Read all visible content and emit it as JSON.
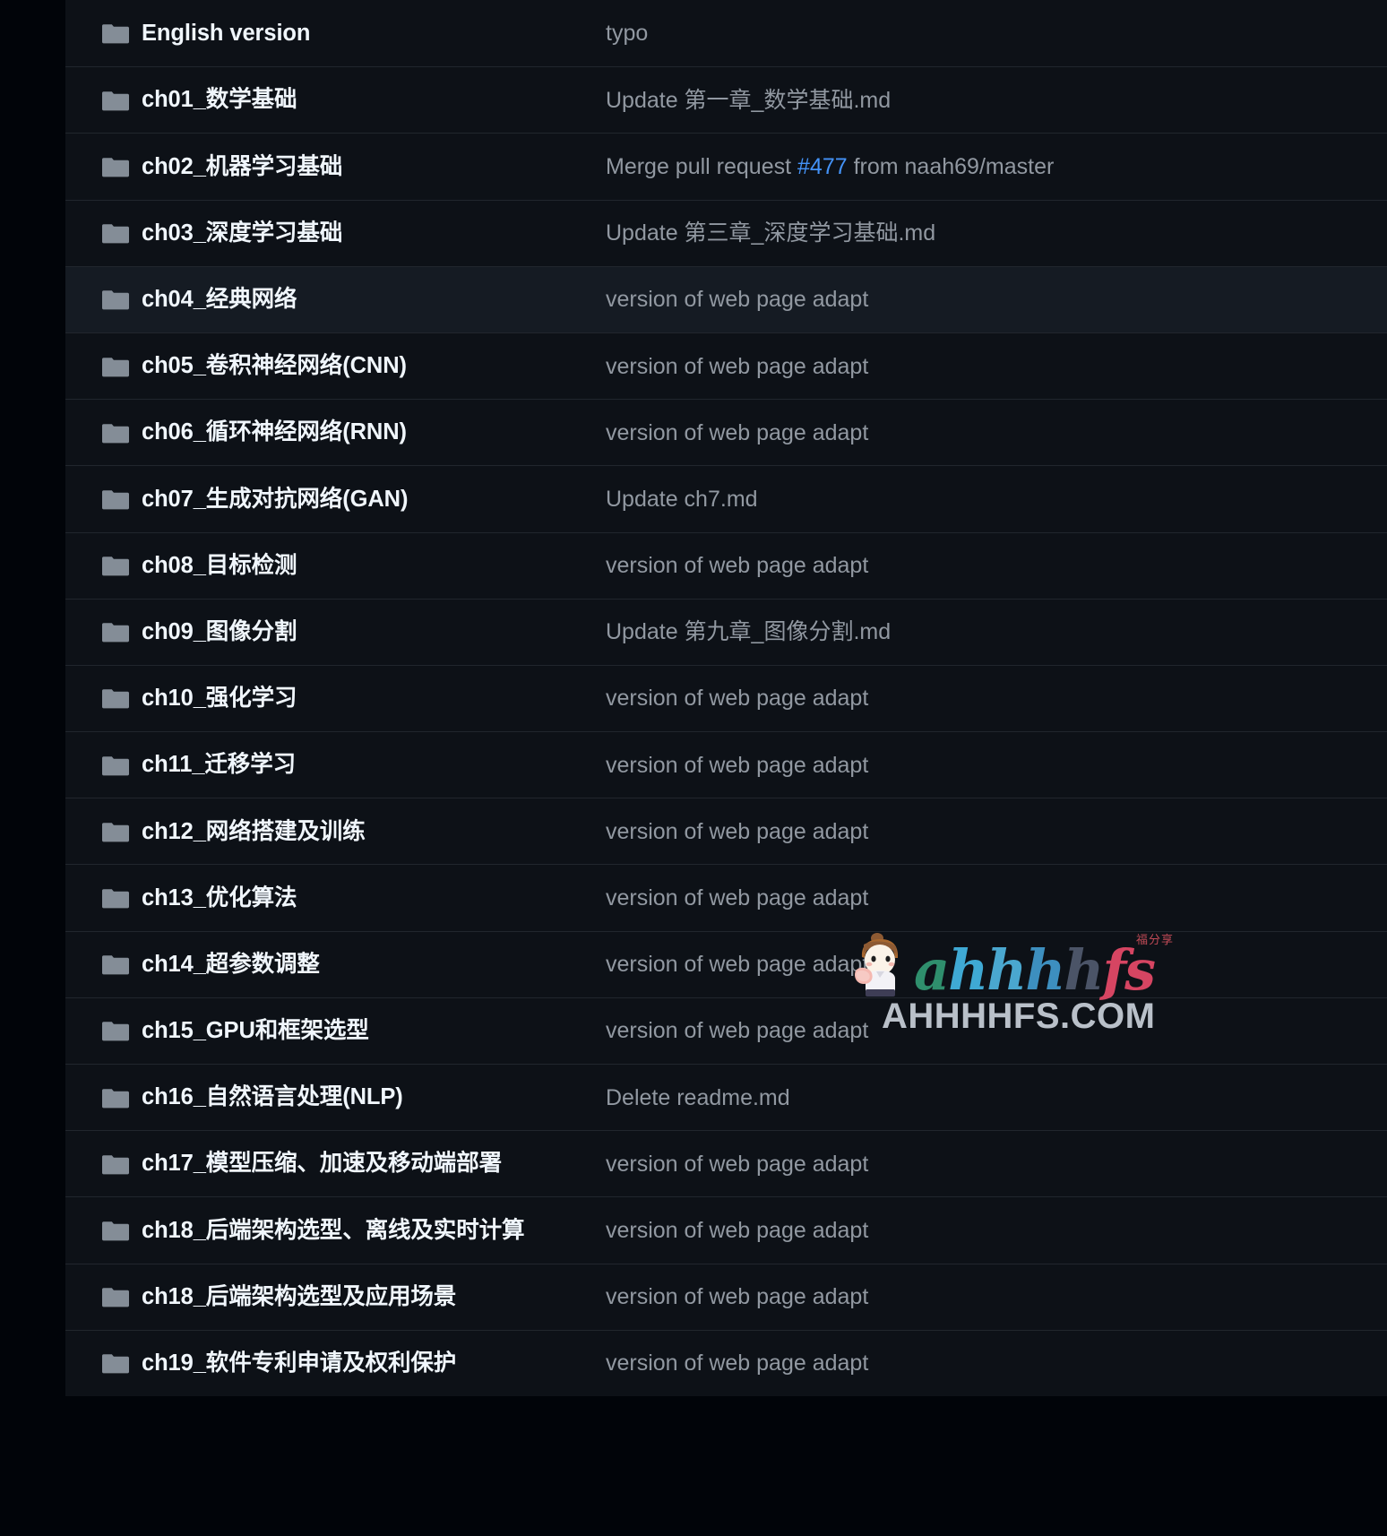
{
  "theme": {
    "page_bg": "#010409",
    "row_bg": "#0d1117",
    "row_bg_alt": "#151b23",
    "row_border": "#21262d",
    "name_color": "#f0f6fc",
    "message_color": "#9198a1",
    "link_color": "#4493f8",
    "folder_icon_color": "#848d97"
  },
  "icons": {
    "folder": "folder-icon"
  },
  "file_list": {
    "columns": [
      "name",
      "last_commit_message"
    ],
    "rows": [
      {
        "icon": "folder-icon",
        "name": "English version",
        "message_pre": "typo",
        "message_link": "",
        "message_post": "",
        "highlighted": false
      },
      {
        "icon": "folder-icon",
        "name": "ch01_数学基础",
        "message_pre": "Update 第一章_数学基础.md",
        "message_link": "",
        "message_post": "",
        "highlighted": false
      },
      {
        "icon": "folder-icon",
        "name": "ch02_机器学习基础",
        "message_pre": "Merge pull request ",
        "message_link": "#477",
        "message_post": " from naah69/master",
        "highlighted": false
      },
      {
        "icon": "folder-icon",
        "name": "ch03_深度学习基础",
        "message_pre": "Update 第三章_深度学习基础.md",
        "message_link": "",
        "message_post": "",
        "highlighted": false
      },
      {
        "icon": "folder-icon",
        "name": "ch04_经典网络",
        "message_pre": "version of web page adapt",
        "message_link": "",
        "message_post": "",
        "highlighted": true
      },
      {
        "icon": "folder-icon",
        "name": "ch05_卷积神经网络(CNN)",
        "message_pre": "version of web page adapt",
        "message_link": "",
        "message_post": "",
        "highlighted": false
      },
      {
        "icon": "folder-icon",
        "name": "ch06_循环神经网络(RNN)",
        "message_pre": "version of web page adapt",
        "message_link": "",
        "message_post": "",
        "highlighted": false
      },
      {
        "icon": "folder-icon",
        "name": "ch07_生成对抗网络(GAN)",
        "message_pre": "Update ch7.md",
        "message_link": "",
        "message_post": "",
        "highlighted": false
      },
      {
        "icon": "folder-icon",
        "name": "ch08_目标检测",
        "message_pre": "version of web page adapt",
        "message_link": "",
        "message_post": "",
        "highlighted": false
      },
      {
        "icon": "folder-icon",
        "name": "ch09_图像分割",
        "message_pre": "Update 第九章_图像分割.md",
        "message_link": "",
        "message_post": "",
        "highlighted": false
      },
      {
        "icon": "folder-icon",
        "name": "ch10_强化学习",
        "message_pre": "version of web page adapt",
        "message_link": "",
        "message_post": "",
        "highlighted": false
      },
      {
        "icon": "folder-icon",
        "name": "ch11_迁移学习",
        "message_pre": "version of web page adapt",
        "message_link": "",
        "message_post": "",
        "highlighted": false
      },
      {
        "icon": "folder-icon",
        "name": "ch12_网络搭建及训练",
        "message_pre": "version of web page adapt",
        "message_link": "",
        "message_post": "",
        "highlighted": false
      },
      {
        "icon": "folder-icon",
        "name": "ch13_优化算法",
        "message_pre": "version of web page adapt",
        "message_link": "",
        "message_post": "",
        "highlighted": false
      },
      {
        "icon": "folder-icon",
        "name": "ch14_超参数调整",
        "message_pre": "version of web page adapt",
        "message_link": "",
        "message_post": "",
        "highlighted": false
      },
      {
        "icon": "folder-icon",
        "name": "ch15_GPU和框架选型",
        "message_pre": "version of web page adapt",
        "message_link": "",
        "message_post": "",
        "highlighted": false
      },
      {
        "icon": "folder-icon",
        "name": "ch16_自然语言处理(NLP)",
        "message_pre": "Delete readme.md",
        "message_link": "",
        "message_post": "",
        "highlighted": false
      },
      {
        "icon": "folder-icon",
        "name": "ch17_模型压缩、加速及移动端部署",
        "message_pre": "version of web page adapt",
        "message_link": "",
        "message_post": "",
        "highlighted": false
      },
      {
        "icon": "folder-icon",
        "name": "ch18_后端架构选型、离线及实时计算",
        "message_pre": "version of web page adapt",
        "message_link": "",
        "message_post": "",
        "highlighted": false
      },
      {
        "icon": "folder-icon",
        "name": "ch18_后端架构选型及应用场景",
        "message_pre": "version of web page adapt",
        "message_link": "",
        "message_post": "",
        "highlighted": false
      },
      {
        "icon": "folder-icon",
        "name": "ch19_软件专利申请及权利保护",
        "message_pre": "version of web page adapt",
        "message_link": "",
        "message_post": "",
        "highlighted": false
      }
    ]
  },
  "watermark": {
    "logo_letters": [
      "a",
      "h",
      "h",
      "h",
      "h",
      "f",
      "s"
    ],
    "cn_note": "福分享",
    "domain": "AHHHHFS.COM"
  }
}
